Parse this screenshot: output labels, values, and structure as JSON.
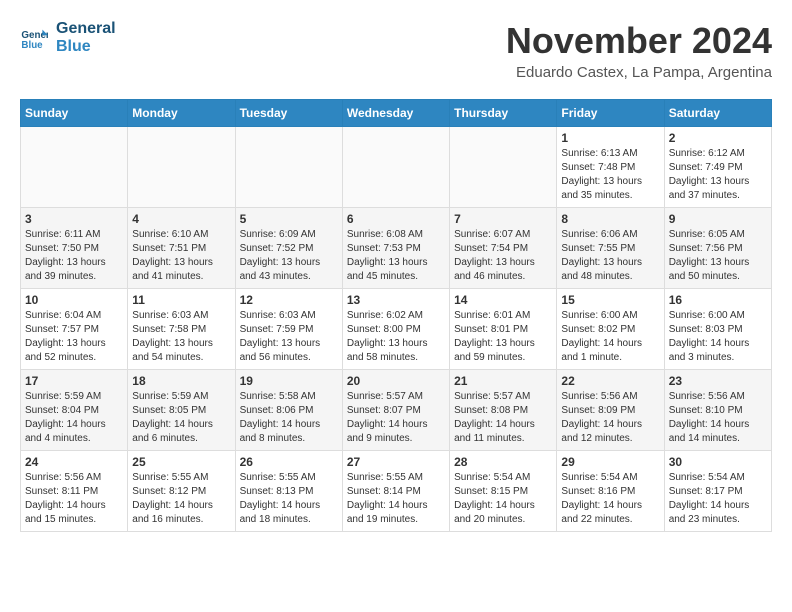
{
  "header": {
    "logo_line1": "General",
    "logo_line2": "Blue",
    "month_title": "November 2024",
    "subtitle": "Eduardo Castex, La Pampa, Argentina"
  },
  "calendar": {
    "days_of_week": [
      "Sunday",
      "Monday",
      "Tuesday",
      "Wednesday",
      "Thursday",
      "Friday",
      "Saturday"
    ],
    "weeks": [
      [
        {
          "day": "",
          "info": ""
        },
        {
          "day": "",
          "info": ""
        },
        {
          "day": "",
          "info": ""
        },
        {
          "day": "",
          "info": ""
        },
        {
          "day": "",
          "info": ""
        },
        {
          "day": "1",
          "info": "Sunrise: 6:13 AM\nSunset: 7:48 PM\nDaylight: 13 hours\nand 35 minutes."
        },
        {
          "day": "2",
          "info": "Sunrise: 6:12 AM\nSunset: 7:49 PM\nDaylight: 13 hours\nand 37 minutes."
        }
      ],
      [
        {
          "day": "3",
          "info": "Sunrise: 6:11 AM\nSunset: 7:50 PM\nDaylight: 13 hours\nand 39 minutes."
        },
        {
          "day": "4",
          "info": "Sunrise: 6:10 AM\nSunset: 7:51 PM\nDaylight: 13 hours\nand 41 minutes."
        },
        {
          "day": "5",
          "info": "Sunrise: 6:09 AM\nSunset: 7:52 PM\nDaylight: 13 hours\nand 43 minutes."
        },
        {
          "day": "6",
          "info": "Sunrise: 6:08 AM\nSunset: 7:53 PM\nDaylight: 13 hours\nand 45 minutes."
        },
        {
          "day": "7",
          "info": "Sunrise: 6:07 AM\nSunset: 7:54 PM\nDaylight: 13 hours\nand 46 minutes."
        },
        {
          "day": "8",
          "info": "Sunrise: 6:06 AM\nSunset: 7:55 PM\nDaylight: 13 hours\nand 48 minutes."
        },
        {
          "day": "9",
          "info": "Sunrise: 6:05 AM\nSunset: 7:56 PM\nDaylight: 13 hours\nand 50 minutes."
        }
      ],
      [
        {
          "day": "10",
          "info": "Sunrise: 6:04 AM\nSunset: 7:57 PM\nDaylight: 13 hours\nand 52 minutes."
        },
        {
          "day": "11",
          "info": "Sunrise: 6:03 AM\nSunset: 7:58 PM\nDaylight: 13 hours\nand 54 minutes."
        },
        {
          "day": "12",
          "info": "Sunrise: 6:03 AM\nSunset: 7:59 PM\nDaylight: 13 hours\nand 56 minutes."
        },
        {
          "day": "13",
          "info": "Sunrise: 6:02 AM\nSunset: 8:00 PM\nDaylight: 13 hours\nand 58 minutes."
        },
        {
          "day": "14",
          "info": "Sunrise: 6:01 AM\nSunset: 8:01 PM\nDaylight: 13 hours\nand 59 minutes."
        },
        {
          "day": "15",
          "info": "Sunrise: 6:00 AM\nSunset: 8:02 PM\nDaylight: 14 hours\nand 1 minute."
        },
        {
          "day": "16",
          "info": "Sunrise: 6:00 AM\nSunset: 8:03 PM\nDaylight: 14 hours\nand 3 minutes."
        }
      ],
      [
        {
          "day": "17",
          "info": "Sunrise: 5:59 AM\nSunset: 8:04 PM\nDaylight: 14 hours\nand 4 minutes."
        },
        {
          "day": "18",
          "info": "Sunrise: 5:59 AM\nSunset: 8:05 PM\nDaylight: 14 hours\nand 6 minutes."
        },
        {
          "day": "19",
          "info": "Sunrise: 5:58 AM\nSunset: 8:06 PM\nDaylight: 14 hours\nand 8 minutes."
        },
        {
          "day": "20",
          "info": "Sunrise: 5:57 AM\nSunset: 8:07 PM\nDaylight: 14 hours\nand 9 minutes."
        },
        {
          "day": "21",
          "info": "Sunrise: 5:57 AM\nSunset: 8:08 PM\nDaylight: 14 hours\nand 11 minutes."
        },
        {
          "day": "22",
          "info": "Sunrise: 5:56 AM\nSunset: 8:09 PM\nDaylight: 14 hours\nand 12 minutes."
        },
        {
          "day": "23",
          "info": "Sunrise: 5:56 AM\nSunset: 8:10 PM\nDaylight: 14 hours\nand 14 minutes."
        }
      ],
      [
        {
          "day": "24",
          "info": "Sunrise: 5:56 AM\nSunset: 8:11 PM\nDaylight: 14 hours\nand 15 minutes."
        },
        {
          "day": "25",
          "info": "Sunrise: 5:55 AM\nSunset: 8:12 PM\nDaylight: 14 hours\nand 16 minutes."
        },
        {
          "day": "26",
          "info": "Sunrise: 5:55 AM\nSunset: 8:13 PM\nDaylight: 14 hours\nand 18 minutes."
        },
        {
          "day": "27",
          "info": "Sunrise: 5:55 AM\nSunset: 8:14 PM\nDaylight: 14 hours\nand 19 minutes."
        },
        {
          "day": "28",
          "info": "Sunrise: 5:54 AM\nSunset: 8:15 PM\nDaylight: 14 hours\nand 20 minutes."
        },
        {
          "day": "29",
          "info": "Sunrise: 5:54 AM\nSunset: 8:16 PM\nDaylight: 14 hours\nand 22 minutes."
        },
        {
          "day": "30",
          "info": "Sunrise: 5:54 AM\nSunset: 8:17 PM\nDaylight: 14 hours\nand 23 minutes."
        }
      ]
    ]
  }
}
